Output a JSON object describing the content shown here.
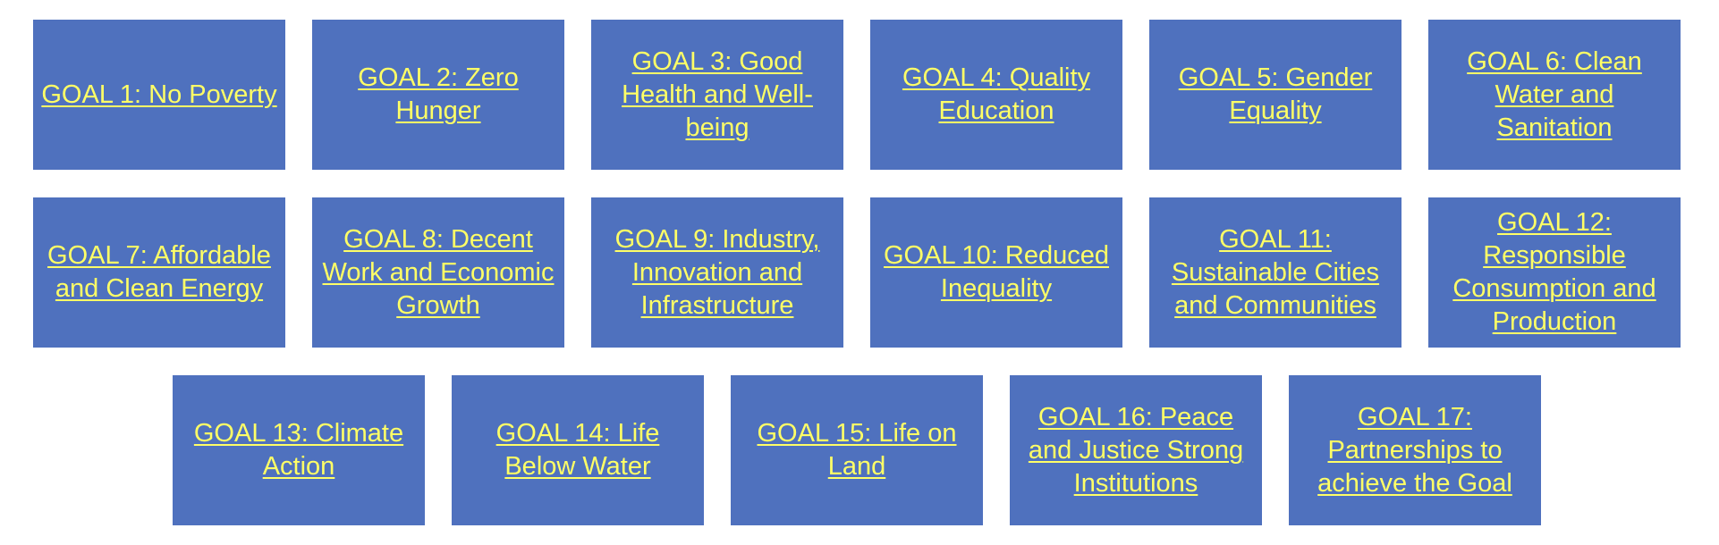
{
  "goals": [
    {
      "label": "GOAL 1: No Poverty"
    },
    {
      "label": "GOAL 2: Zero Hunger"
    },
    {
      "label": "GOAL 3: Good Health and Well-being"
    },
    {
      "label": "GOAL 4: Quality Education"
    },
    {
      "label": "GOAL 5: Gender Equality"
    },
    {
      "label": "GOAL 6: Clean Water and Sanitation"
    },
    {
      "label": "GOAL 7: Affordable and Clean Energy"
    },
    {
      "label": "GOAL 8: Decent Work and Economic Growth"
    },
    {
      "label": "GOAL 9: Industry, Innovation and Infrastructure"
    },
    {
      "label": "GOAL 10: Reduced Inequality"
    },
    {
      "label": "GOAL 11: Sustainable Cities and Communities"
    },
    {
      "label": "GOAL 12: Responsible Consumption and Production"
    },
    {
      "label": "GOAL 13: Climate Action"
    },
    {
      "label": "GOAL 14: Life Below Water"
    },
    {
      "label": "GOAL 15: Life on Land"
    },
    {
      "label": "GOAL 16: Peace and Justice Strong Institutions"
    },
    {
      "label": "GOAL 17: Partnerships to achieve the Goal"
    }
  ],
  "colors": {
    "tile_background": "#4f71be",
    "link_text": "#ffff66",
    "page_background": "#ffffff"
  }
}
